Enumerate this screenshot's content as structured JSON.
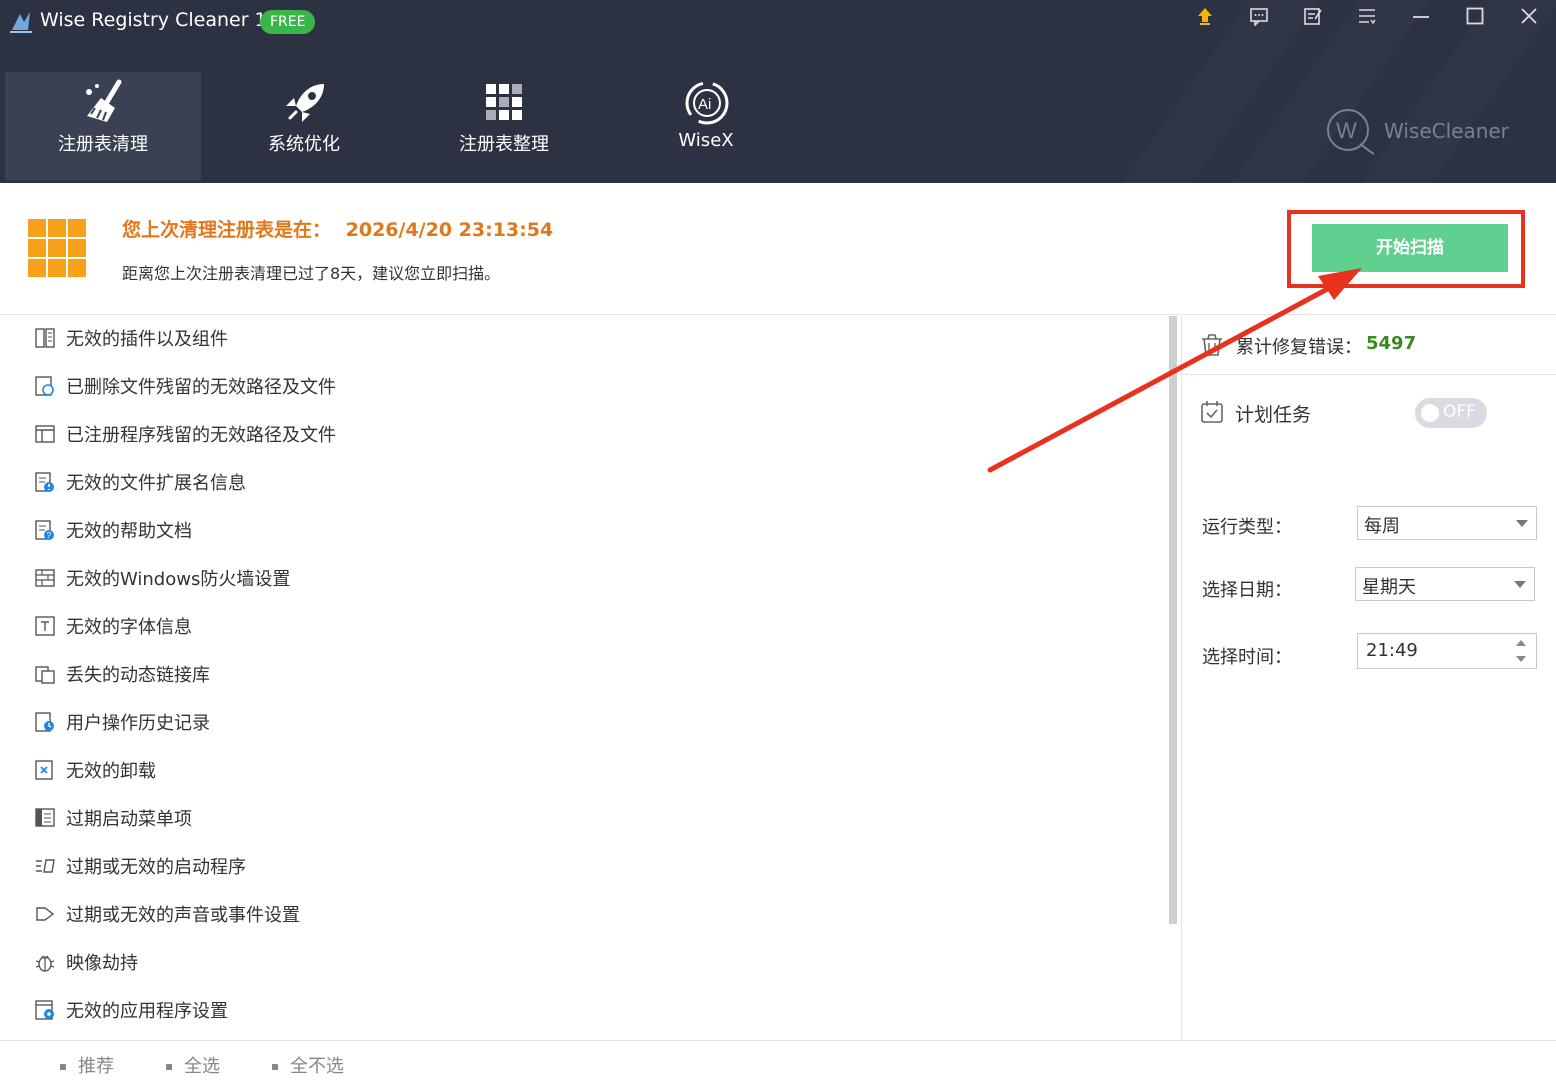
{
  "window": {
    "title": "Wise Registry Cleaner 11",
    "badge": "FREE",
    "controls": [
      "upgrade-icon",
      "feedback-icon",
      "notes-icon",
      "menu-icon",
      "minimize-icon",
      "maximize-icon",
      "close-icon"
    ]
  },
  "nav": {
    "tabs": [
      {
        "label": "注册表清理",
        "icon": "broom-icon",
        "active": true
      },
      {
        "label": "系统优化",
        "icon": "rocket-icon",
        "active": false
      },
      {
        "label": "注册表整理",
        "icon": "grid-icon",
        "active": false
      },
      {
        "label": "WiseX",
        "icon": "ai-swirl-icon",
        "active": false
      }
    ],
    "brand": "WiseCleaner"
  },
  "info": {
    "last_clean_label": "您上次清理注册表是在：",
    "last_clean_time": "2026/4/20 23:13:54",
    "advice": "距离您上次注册表清理已过了8天，建议您立即扫描。",
    "scan_button": "开始扫描"
  },
  "categories": [
    {
      "label": "无效的插件以及组件",
      "icon": "plugin-icon"
    },
    {
      "label": "已删除文件残留的无效路径及文件",
      "icon": "deleted-path-icon"
    },
    {
      "label": "已注册程序残留的无效路径及文件",
      "icon": "program-path-icon"
    },
    {
      "label": "无效的文件扩展名信息",
      "icon": "file-extension-icon"
    },
    {
      "label": "无效的帮助文档",
      "icon": "help-doc-icon"
    },
    {
      "label": "无效的Windows防火墙设置",
      "icon": "firewall-icon"
    },
    {
      "label": "无效的字体信息",
      "icon": "font-icon"
    },
    {
      "label": "丢失的动态链接库",
      "icon": "dll-icon"
    },
    {
      "label": "用户操作历史记录",
      "icon": "history-icon"
    },
    {
      "label": "无效的卸载",
      "icon": "uninstall-icon"
    },
    {
      "label": "过期启动菜单项",
      "icon": "start-menu-icon"
    },
    {
      "label": "过期或无效的启动程序",
      "icon": "startup-icon"
    },
    {
      "label": "过期或无效的声音或事件设置",
      "icon": "sound-icon"
    },
    {
      "label": "映像劫持",
      "icon": "bug-icon"
    },
    {
      "label": "无效的应用程序设置",
      "icon": "app-settings-icon"
    }
  ],
  "bottom": {
    "recommended": "推荐",
    "select_all": "全选",
    "select_none": "全不选"
  },
  "panel": {
    "stat_label": "累计修复错误：",
    "stat_value": "5497",
    "task_label": "计划任务",
    "toggle": "OFF",
    "run_type_label": "运行类型：",
    "run_type_value": "每周",
    "date_label": "选择日期：",
    "date_value": "星期天",
    "time_label": "选择时间：",
    "time_value": "21:49"
  },
  "colors": {
    "header_bg": "#2c3241",
    "accent_orange": "#e0781a",
    "scan_green": "#5fd08e",
    "highlight_red": "#e8321e",
    "stat_green": "#3a8a1e"
  }
}
